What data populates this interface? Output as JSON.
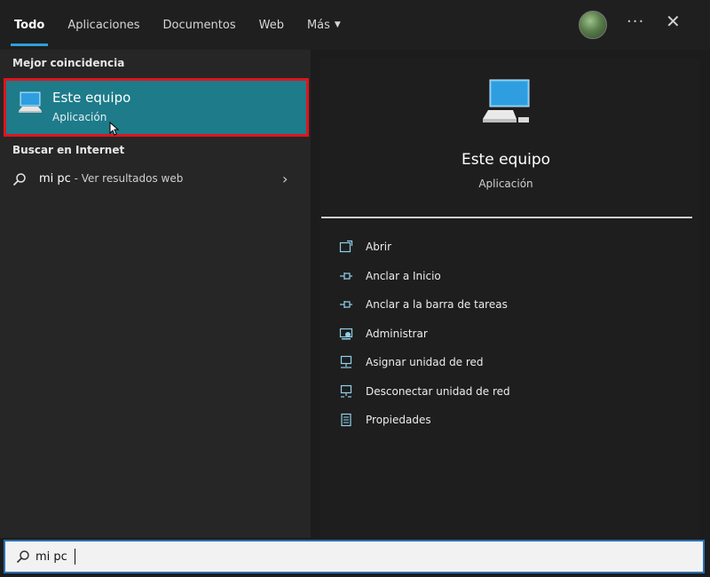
{
  "topbar": {
    "tabs": [
      {
        "label": "Todo",
        "active": true
      },
      {
        "label": "Aplicaciones",
        "active": false
      },
      {
        "label": "Documentos",
        "active": false
      },
      {
        "label": "Web",
        "active": false
      },
      {
        "label": "Más",
        "active": false
      }
    ],
    "more_icon": "ellipsis-icon",
    "close_icon": "close-icon"
  },
  "left": {
    "best_match_label": "Mejor coincidencia",
    "best_match": {
      "title": "Este equipo",
      "subtitle": "Aplicación",
      "icon": "computer-icon"
    },
    "web_label": "Buscar en Internet",
    "web_result": {
      "query": "mi pc",
      "suffix": " - Ver resultados web"
    }
  },
  "detail": {
    "title": "Este equipo",
    "subtitle": "Aplicación",
    "actions": [
      {
        "label": "Abrir",
        "icon": "open-icon"
      },
      {
        "label": "Anclar a Inicio",
        "icon": "pin-icon"
      },
      {
        "label": "Anclar a la barra de tareas",
        "icon": "pin-icon"
      },
      {
        "label": "Administrar",
        "icon": "manage-icon"
      },
      {
        "label": "Asignar unidad de red",
        "icon": "network-drive-icon"
      },
      {
        "label": "Desconectar unidad de red",
        "icon": "disconnect-drive-icon"
      },
      {
        "label": "Propiedades",
        "icon": "properties-icon"
      }
    ]
  },
  "search": {
    "value": "mi pc"
  },
  "colors": {
    "accent": "#2d9fd8",
    "selection": "#1d7b8a",
    "highlight_border": "#e0141e"
  }
}
